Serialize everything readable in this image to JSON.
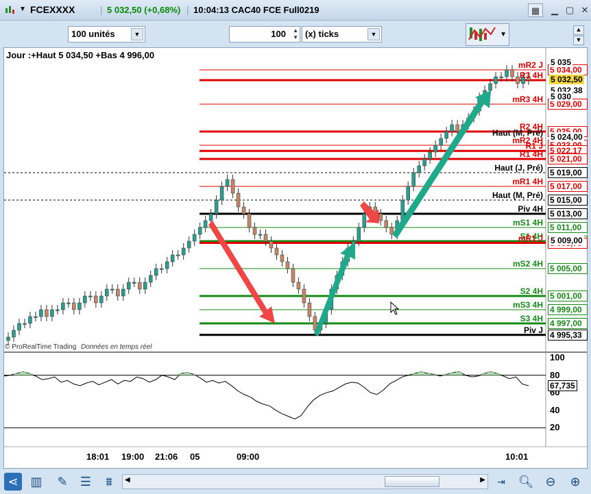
{
  "titlebar": {
    "symbol": "FCEXXXX",
    "price_change": "5 032,50 (+0,68%)",
    "info": "10:04:13 CAC40 FCE Full0219"
  },
  "toolbar": {
    "units_value": "100 unités",
    "ticks_value": "100",
    "ticks_unit": "(x) ticks"
  },
  "chart": {
    "header": "Jour :+Haut 5 034,50 +Bas 4 996,00",
    "source": "© ProRealTime Trading",
    "source_note": "Données en temps réel",
    "colors": {
      "up": "#2e9c8c",
      "down": "#c0876a",
      "red_level": "#e00000",
      "green_level": "#148a14",
      "arrow_red": "#f04040",
      "arrow_green": "#1fa88a"
    },
    "levels": [
      {
        "label": "mR2 J",
        "price": "5 034,00",
        "kind": "red-thin"
      },
      {
        "label": "R3 4H",
        "price": "",
        "kind": "red-thick"
      },
      {
        "label": "mR3 4H",
        "price": "5 029,00",
        "kind": "red-thin"
      },
      {
        "label": "R2 4H",
        "price": "5 025,00",
        "kind": "red-thick"
      },
      {
        "label": "Haut (M, Pré)",
        "price": "",
        "kind": "label-only"
      },
      {
        "label": "mR2 4H",
        "price": "5 023,00",
        "kind": "red-thin"
      },
      {
        "label": "R1 J",
        "price": "5 022,17",
        "kind": "red-thick"
      },
      {
        "label": "R1 4H",
        "price": "5 021,00",
        "kind": "red-thick"
      },
      {
        "label": "Haut (J, Pré)",
        "price": "5 019,00",
        "kind": "black-dash"
      },
      {
        "label": "mR1 4H",
        "price": "5 017,00",
        "kind": "red-thin"
      },
      {
        "label": "Haut (M, Pré)",
        "price": "5 015,00",
        "kind": "black-dash"
      },
      {
        "label": "Piv 4H",
        "price": "5 013,00",
        "kind": "black-thick"
      },
      {
        "label": "mS1 4H",
        "price": "5 011,00",
        "kind": "green-thin"
      },
      {
        "label": "S1 4H",
        "price": "5 009,00",
        "kind": "green-thick"
      },
      {
        "label": "mR1 J",
        "price": "5 008,75",
        "kind": "red-thick"
      },
      {
        "label": "mS2 4H",
        "price": "5 005,00",
        "kind": "green-thin"
      },
      {
        "label": "S2 4H",
        "price": "5 001,00",
        "kind": "green-thick"
      },
      {
        "label": "mS3 4H",
        "price": "4 999,00",
        "kind": "green-thin"
      },
      {
        "label": "S3 4H",
        "price": "4 997,00",
        "kind": "green-thick"
      },
      {
        "label": "Piv J",
        "price": "4 995,33",
        "kind": "black-thick"
      }
    ],
    "axis_prices": [
      "5 035",
      "5 032,50",
      "5 032,38",
      "5 030",
      "5 024,00",
      "5 009,00"
    ],
    "current_price": "5 032,50",
    "last_price": "5 032,38",
    "osc_ticks": [
      "100",
      "80",
      "60",
      "40",
      "20"
    ],
    "osc_value": "67,735",
    "time_labels": [
      "18:01",
      "19:00",
      "21:06",
      "05",
      "09:00",
      "10:01"
    ]
  },
  "chart_data": {
    "type": "line",
    "title": "Jour :+Haut 5 034,50 +Bas 4 996,00",
    "price_series": {
      "name": "",
      "values": [
        4995,
        4996,
        4997,
        4997,
        4998,
        4998,
        4999,
        4998,
        4999,
        4999,
        5000,
        5000,
        4999,
        5000,
        5001,
        5001,
        5000,
        5001,
        5002,
        5002,
        5001,
        5002,
        5003,
        5003,
        5002,
        5003,
        5004,
        5005,
        5005,
        5006,
        5007,
        5007,
        5008,
        5009,
        5010,
        5011,
        5012,
        5013,
        5015,
        5017,
        5018,
        5016,
        5014,
        5013,
        5011,
        5010,
        5010,
        5009,
        5008,
        5007,
        5006,
        5005,
        5003,
        5002,
        5000,
        4998,
        4996,
        4997,
        4999,
        5002,
        5004,
        5006,
        5008,
        5009,
        5011,
        5013,
        5014,
        5013,
        5012,
        5011,
        5010,
        5012,
        5015,
        5017,
        5019,
        5020,
        5021,
        5022,
        5023,
        5024,
        5025,
        5026,
        5025,
        5026,
        5027,
        5028,
        5030,
        5031,
        5032,
        5033,
        5033,
        5034,
        5033,
        5032,
        5033,
        5032.5
      ]
    },
    "oscillator": {
      "ylim": [
        0,
        100
      ],
      "levels": [
        80,
        20
      ],
      "last": 67.735
    },
    "ylim": [
      4994,
      5036
    ]
  }
}
